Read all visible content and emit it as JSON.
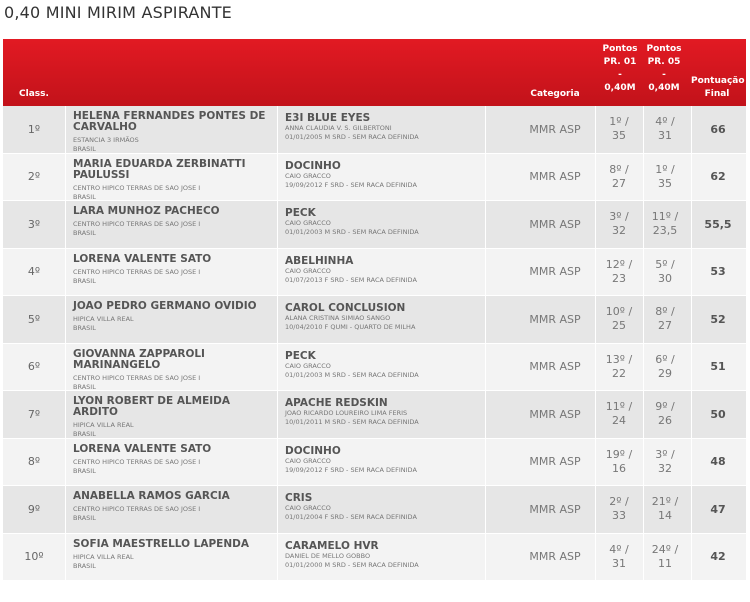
{
  "title": "0,40 MINI MIRIM ASPIRANTE",
  "header": {
    "class": "Class.",
    "categoria": "Categoria",
    "pontos_pr01": [
      "Pontos",
      "PR. 01",
      "-",
      "0,40M"
    ],
    "pontos_pr05": [
      "Pontos",
      "PR. 05",
      "-",
      "0,40M"
    ],
    "final": [
      "Pontuação",
      "Final"
    ]
  },
  "rows": [
    {
      "class": "1º",
      "rider": "HELENA FERNANDES PONTES DE CARVALHO",
      "club": "ESTANCIA 3 IRMÃOS",
      "country": "BRASIL",
      "horse": "E3I BLUE EYES",
      "owner": "ANNA CLAUDIA V. S. GILBERTONI",
      "horse_info": "01/01/2005 M SRD - SEM RACA DEFINIDA",
      "category": "MMR ASP",
      "pr01_pos": "1º /",
      "pr01_pts": "35",
      "pr05_pos": "4º /",
      "pr05_pts": "31",
      "final": "66"
    },
    {
      "class": "2º",
      "rider": "MARIA EDUARDA ZERBINATTI PAULUSSI",
      "club": "CENTRO HIPICO TERRAS DE SAO JOSE I",
      "country": "BRASIL",
      "horse": "DOCINHO",
      "owner": "CAIO GRACCO",
      "horse_info": "19/09/2012 F SRD - SEM RACA DEFINIDA",
      "category": "MMR ASP",
      "pr01_pos": "8º /",
      "pr01_pts": "27",
      "pr05_pos": "1º /",
      "pr05_pts": "35",
      "final": "62"
    },
    {
      "class": "3º",
      "rider": "LARA MUNHOZ PACHECO",
      "club": "CENTRO HIPICO TERRAS DE SAO JOSE I",
      "country": "BRASIL",
      "horse": "PECK",
      "owner": "CAIO GRACCO",
      "horse_info": "01/01/2003 M SRD - SEM RACA DEFINIDA",
      "category": "MMR ASP",
      "pr01_pos": "3º /",
      "pr01_pts": "32",
      "pr05_pos": "11º /",
      "pr05_pts": "23,5",
      "final": "55,5"
    },
    {
      "class": "4º",
      "rider": "LORENA VALENTE SATO",
      "club": "CENTRO HIPICO TERRAS DE SAO JOSE I",
      "country": "BRASIL",
      "horse": "ABELHINHA",
      "owner": "CAIO GRACCO",
      "horse_info": "01/07/2013 F SRD - SEM RACA DEFINIDA",
      "category": "MMR ASP",
      "pr01_pos": "12º /",
      "pr01_pts": "23",
      "pr05_pos": "5º /",
      "pr05_pts": "30",
      "final": "53"
    },
    {
      "class": "5º",
      "rider": "JOAO PEDRO GERMANO OVIDIO",
      "club": "HIPICA VILLA REAL",
      "country": "BRASIL",
      "horse": "CAROL CONCLUSION",
      "owner": "ALANA CRISTINA SIMIAO SANGO",
      "horse_info": "10/04/2010 F QUMI - QUARTO DE MILHA",
      "category": "MMR ASP",
      "pr01_pos": "10º /",
      "pr01_pts": "25",
      "pr05_pos": "8º /",
      "pr05_pts": "27",
      "final": "52"
    },
    {
      "class": "6º",
      "rider": "GIOVANNA ZAPPAROLI MARINANGELO",
      "club": "CENTRO HIPICO TERRAS DE SAO JOSE I",
      "country": "BRASIL",
      "horse": "PECK",
      "owner": "CAIO GRACCO",
      "horse_info": "01/01/2003 M SRD - SEM RACA DEFINIDA",
      "category": "MMR ASP",
      "pr01_pos": "13º /",
      "pr01_pts": "22",
      "pr05_pos": "6º /",
      "pr05_pts": "29",
      "final": "51"
    },
    {
      "class": "7º",
      "rider": "LYON ROBERT DE ALMEIDA ARDITO",
      "club": "HIPICA VILLA REAL",
      "country": "BRASIL",
      "horse": "APACHE REDSKIN",
      "owner": "JOAO RICARDO LOUREIRO LIMA FERIS",
      "horse_info": "10/01/2011 M SRD - SEM RACA DEFINIDA",
      "category": "MMR ASP",
      "pr01_pos": "11º /",
      "pr01_pts": "24",
      "pr05_pos": "9º /",
      "pr05_pts": "26",
      "final": "50"
    },
    {
      "class": "8º",
      "rider": "LORENA VALENTE SATO",
      "club": "CENTRO HIPICO TERRAS DE SAO JOSE I",
      "country": "BRASIL",
      "horse": "DOCINHO",
      "owner": "CAIO GRACCO",
      "horse_info": "19/09/2012 F SRD - SEM RACA DEFINIDA",
      "category": "MMR ASP",
      "pr01_pos": "19º /",
      "pr01_pts": "16",
      "pr05_pos": "3º /",
      "pr05_pts": "32",
      "final": "48"
    },
    {
      "class": "9º",
      "rider": "ANABELLA RAMOS GARCIA",
      "club": "CENTRO HIPICO TERRAS DE SAO JOSE I",
      "country": "BRASIL",
      "horse": "CRIS",
      "owner": "CAIO GRACCO",
      "horse_info": "01/01/2004 F SRD - SEM RACA DEFINIDA",
      "category": "MMR ASP",
      "pr01_pos": "2º /",
      "pr01_pts": "33",
      "pr05_pos": "21º /",
      "pr05_pts": "14",
      "final": "47"
    },
    {
      "class": "10º",
      "rider": "SOFIA MAESTRELLO LAPENDA",
      "club": "HIPICA VILLA REAL",
      "country": "BRASIL",
      "horse": "CARAMELO HVR",
      "owner": "DANIEL DE MELLO GOBBO",
      "horse_info": "01/01/2000 M SRD - SEM RACA DEFINIDA",
      "category": "MMR ASP",
      "pr01_pos": "4º /",
      "pr01_pts": "31",
      "pr05_pos": "24º /",
      "pr05_pts": "11",
      "final": "42"
    }
  ]
}
